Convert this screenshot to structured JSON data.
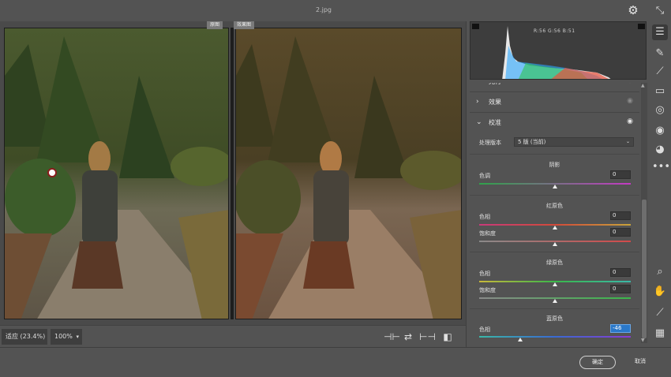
{
  "window": {
    "title": "2.jpg"
  },
  "preview": {
    "before_tag": "原图",
    "after_tag": "效果图",
    "fit_label": "适应 (23.4%)",
    "zoom_value": "100%"
  },
  "histogram": {
    "rgb_readout": "R:56  G:56  B:51"
  },
  "panel": {
    "sec_prev_label": "光行",
    "effects_label": "效果",
    "calibration_label": "校准",
    "process_label": "处理版本",
    "process_value": "5 版 (当前)",
    "shadows": {
      "title": "阴影",
      "tint_label": "色调",
      "tint_value": "0"
    },
    "red": {
      "title": "红原色",
      "hue_label": "色相",
      "hue_value": "0",
      "sat_label": "饱和度",
      "sat_value": "0"
    },
    "green": {
      "title": "绿原色",
      "hue_label": "色相",
      "hue_value": "0",
      "sat_label": "饱和度",
      "sat_value": "0"
    },
    "blue": {
      "title": "蓝原色",
      "hue_label": "色相",
      "hue_value": "-46",
      "sat_label": "饱和度",
      "sat_value": "0"
    }
  },
  "slider_levels": {
    "shadow_tint": 0.5,
    "red_hue": 0.5,
    "red_sat": 0.5,
    "green_hue": 0.5,
    "green_sat": 0.5,
    "blue_hue": 0.27,
    "blue_sat": 0.5
  },
  "footer": {
    "ok_label": "确定",
    "cancel_label": "取消"
  },
  "colors": {
    "accent_focus": "#2a78c9",
    "panel_bg": "#535353"
  }
}
